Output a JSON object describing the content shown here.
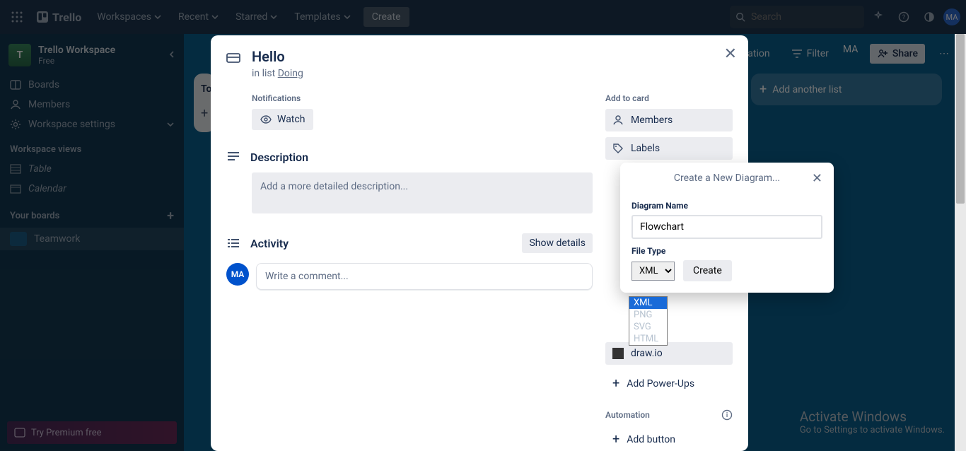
{
  "topnav": {
    "logo": "Trello",
    "items": [
      "Workspaces",
      "Recent",
      "Starred",
      "Templates"
    ],
    "create": "Create",
    "search_placeholder": "Search",
    "avatar_initials": "MA"
  },
  "sidebar": {
    "workspace_initial": "T",
    "workspace_name": "Trello Workspace",
    "workspace_plan": "Free",
    "items": [
      {
        "label": "Boards",
        "icon": "board-icon"
      },
      {
        "label": "Members",
        "icon": "members-icon"
      },
      {
        "label": "Workspace settings",
        "icon": "gear-icon"
      }
    ],
    "views_header": "Workspace views",
    "views": [
      "Table",
      "Calendar"
    ],
    "your_boards_header": "Your boards",
    "boards": [
      "Teamwork"
    ],
    "premium_cta": "Try Premium free"
  },
  "board": {
    "lists": [
      {
        "title": "To",
        "add_card": ""
      }
    ],
    "add_list": "Add another list",
    "header": {
      "automation": "mation",
      "filter": "Filter",
      "share": "Share",
      "avatar": "MA"
    }
  },
  "card_dialog": {
    "title": "Hello",
    "list_prefix": "in list ",
    "list_name": "Doing",
    "notifications_header": "Notifications",
    "watch": "Watch",
    "description_header": "Description",
    "description_placeholder": "Add a more detailed description...",
    "activity_header": "Activity",
    "show_details": "Show details",
    "comment_placeholder": "Write a comment...",
    "avatar_initials": "MA",
    "add_to_card_header": "Add to card",
    "side_buttons": [
      "Members",
      "Labels"
    ],
    "drawio_label": "draw.io",
    "add_powerups": "Add Power-Ups",
    "automation_header": "Automation",
    "add_button": "Add button"
  },
  "popover": {
    "title": "Create a New Diagram...",
    "name_label": "Diagram Name",
    "name_value": "Flowchart",
    "filetype_label": "File Type",
    "filetype_selected": "XML",
    "filetype_options": [
      "XML",
      "PNG",
      "SVG",
      "HTML"
    ],
    "create": "Create"
  },
  "windows_activate": {
    "title": "Activate Windows",
    "subtitle": "Go to Settings to activate Windows."
  }
}
